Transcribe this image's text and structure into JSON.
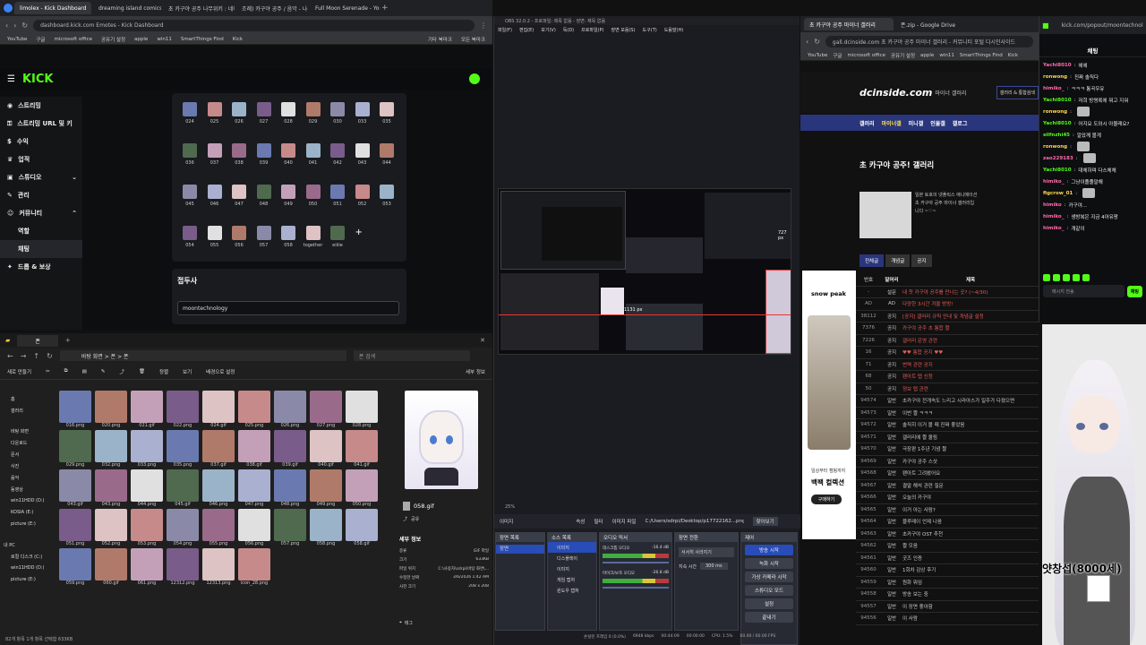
{
  "browser_left": {
    "tabs": [
      "limolex - Kick Dashboard",
      "dreaming island comics princess",
      "초 카구야 공주 나무위키 : 네이버",
      "조례) 카구야 공주 / 음악 - 나무위키",
      "Full Moon Serenade - YouTube"
    ],
    "url": "dashboard.kick.com  Emotes - Kick Dashboard",
    "bookmarks": [
      "YouTube",
      "구글",
      "microsoft office",
      "공유기 설정",
      "apple",
      "win11",
      "SmartThings Find",
      "Kick",
      "기타 북마크",
      "모든 북마크"
    ]
  },
  "kick": {
    "logo": "KICK",
    "sidebar": [
      "스트리밍",
      "스트리밍 URL 및 키",
      "수익",
      "업적",
      "스튜디오",
      "관리",
      "커뮤니티",
      "역할",
      "채팅",
      "드롭 & 보상"
    ],
    "emote_rows": [
      [
        "024",
        "025",
        "026",
        "027",
        "028",
        "029",
        "030",
        "033",
        "035"
      ],
      [
        "036",
        "037",
        "038",
        "039",
        "040",
        "041",
        "042",
        "043",
        "044"
      ],
      [
        "045",
        "046",
        "047",
        "048",
        "049",
        "050",
        "051",
        "052",
        "053"
      ],
      [
        "054",
        "055",
        "056",
        "057",
        "058",
        "together",
        "eiiiie"
      ]
    ],
    "section_title": "접두사",
    "prefix_value": "moontechnology"
  },
  "explorer": {
    "tab": "폰",
    "path": "바탕 화면  >  폰  >  폰",
    "search_placeholder": "폰 검색",
    "toolbar": [
      "새로 만들기",
      "정렬",
      "보기",
      "배경으로 설정",
      "세부 정보"
    ],
    "nav_items": [
      "홈",
      "갤러리",
      "바탕 화면",
      "다운로드",
      "문서",
      "사진",
      "음악",
      "동영상",
      "win11HDD (D:)",
      "KOSIA (E:)",
      "picture (E:)",
      "내 PC",
      "로컬 디스크 (C:)",
      "win11HDD (D:)",
      "picture (E:)"
    ],
    "files": [
      "016.png",
      "020.png",
      "021.gif",
      "022.png",
      "024.gif",
      "025.png",
      "026.png",
      "027.png",
      "028.png",
      "029.png",
      "032.png",
      "033.png",
      "035.png",
      "037.gif",
      "038.gif",
      "039.gif",
      "040.gif",
      "041.gif",
      "043.gif",
      "043.png",
      "044.png",
      "045.gif",
      "046.png",
      "047.png",
      "048.png",
      "049.png",
      "050.png",
      "051.png",
      "052.png",
      "053.png",
      "054.png",
      "055.png",
      "056.png",
      "057.png",
      "058.png",
      "058.gif",
      "059.png",
      "060.gif",
      "061.png",
      "12312.png",
      "12313.png",
      "icon_28.png"
    ],
    "preview_file": "058.gif",
    "preview_share": "공유",
    "detail_title": "세부 정보",
    "details": [
      [
        "종류",
        "GIF 파일"
      ],
      [
        "크기",
        "633KB"
      ],
      [
        "파일 위치",
        "C:\\사용자\\sdrpi\\바탕 화면\\..."
      ],
      [
        "수정한 날짜",
        "3/6/2026 1:42 AM"
      ],
      [
        "사진 크기",
        "208 x 208"
      ]
    ],
    "status": "82개 항목   1개 항목 선택함 633KB",
    "tag_button": "태그"
  },
  "obs": {
    "title": "OBS 32.0.2 - 프로파일: 제목 없음 - 장면: 제목 없음",
    "menu": [
      "파일(F)",
      "편집(E)",
      "보기(V)",
      "독(D)",
      "프로파일(P)",
      "장면 모음(S)",
      "도구(T)",
      "도움말(H)"
    ],
    "zoom": "25%",
    "image_label": "1131 px",
    "px_label": "727 px",
    "toolbar": [
      "이미지",
      "속성",
      "필터",
      "이미지 파일",
      "C:/Users/sdrpi/Desktop/p17722162...png",
      "찾아보기"
    ],
    "scene_panel": "장면 목록",
    "scenes": [
      "장면"
    ],
    "source_panel": "소스 목록",
    "sources": [
      "이미지",
      "디스플레이",
      "이미지",
      "게임 캡처",
      "윈도우 캡처"
    ],
    "audio_panel": "오디오 믹서",
    "audio": [
      {
        "name": "데스크톱 오디오",
        "db": "-16.4 dB"
      },
      {
        "name": "마이크/보조 오디오",
        "db": "-26.8 dB"
      }
    ],
    "transition_panel": "장면 전환",
    "transition": "서서히 사라지기",
    "duration_label": "지속 시간",
    "duration": "300 ms",
    "controls_panel": "제어",
    "controls": [
      "방송 시작",
      "녹화 시작",
      "가상 카메라 시작",
      "스튜디오 모드",
      "설정",
      "끝내기"
    ],
    "status": [
      "손실된 프레임 0 (0.0%)",
      "6948 kbps",
      "00:44:09",
      "00:00:00",
      "CPU: 1.5%",
      "60.00 / 60.00 FPS"
    ]
  },
  "browser_right": {
    "tabs": [
      "초 카구야 공주 마이너 갤러리",
      "폰.zip - Google Drive"
    ],
    "url": "gall.dcinside.com  초 카구야 공주 마이너 갤러리 - 커뮤니티 포털 디시인사이드",
    "bookmarks": [
      "YouTube",
      "구글",
      "microsoft office",
      "공유기 설정",
      "apple",
      "win11",
      "SmartThings Find",
      "Kick"
    ]
  },
  "dc": {
    "logo": "dcinside.com",
    "logo_sub": "마이너 갤러리",
    "search_btn": "갤러리 & 통합검색",
    "nav": [
      "갤러리",
      "마이너갤",
      "미니갤",
      "인물갤",
      "갤로그"
    ],
    "gallery_title": "초 카구야 공주! 갤러리",
    "intro": "일본 토호의 넷플릭스 애니메이션 초 카구야 공주 마이너 갤러리입니다 ~♡~",
    "tabs": [
      "전체글",
      "개념글",
      "공지"
    ],
    "cols": [
      "번호",
      "말머리",
      "제목"
    ],
    "ad_brand": "snow peak",
    "ad_text1": "일상부터 캠핑까지",
    "ad_text2": "백팩 컬렉션",
    "ad_btn": "구매하기",
    "rows": [
      [
        "-",
        "설문",
        "내 첫 카구야 공주를 만나는 곳? (~4/30)"
      ],
      [
        "AD",
        "AD",
        "다양한 3시간 겨울 방방!"
      ],
      [
        "38112",
        "공지",
        "[공지] 갤러리 규칙 안내 및 개념글 설정"
      ],
      [
        "7376",
        "공지",
        "카구야 공주 초 통합 짤"
      ],
      [
        "7226",
        "공지",
        "갤러리 운영 관련"
      ],
      [
        "16",
        "공지",
        "♥♥ 통합 공지 ♥♥"
      ],
      [
        "71",
        "공지",
        "번역 관련 공지"
      ],
      [
        "68",
        "공지",
        "팬아트 탭 신청"
      ],
      [
        "50",
        "공지",
        "정보 탭 관련"
      ],
      [
        "94574",
        "일반",
        "초카구야 전개속도 느리고 시라아스가 일주가 다졌으면"
      ],
      [
        "94573",
        "일반",
        "이번 짤 ㅋㅋㅋ"
      ],
      [
        "94572",
        "일반",
        "솔직히 이거 볼 때 진짜 좋았음"
      ],
      [
        "94571",
        "일반",
        "갤러리에 짤 올림"
      ],
      [
        "94570",
        "일반",
        "극장판 1주년 기념 짤"
      ],
      [
        "94569",
        "일반",
        "카구야 공주 스샷"
      ],
      [
        "94568",
        "일반",
        "팬아트 그려봤어요"
      ],
      [
        "94567",
        "일반",
        "결말 해석 관련 질문"
      ],
      [
        "94566",
        "일반",
        "오늘의 카구야"
      ],
      [
        "94565",
        "일반",
        "이거 아는 사람?"
      ],
      [
        "94564",
        "일반",
        "블루레이 언제 나옴"
      ],
      [
        "94563",
        "일반",
        "초카구야 OST 추천"
      ],
      [
        "94562",
        "일반",
        "짤 모음"
      ],
      [
        "94561",
        "일반",
        "굿즈 인증"
      ],
      [
        "94560",
        "일반",
        "1회차 감상 후기"
      ],
      [
        "94559",
        "일반",
        "원화 뭐임"
      ],
      [
        "94558",
        "일반",
        "방송 보는 중"
      ],
      [
        "94557",
        "일반",
        "이 장면 좋아함"
      ],
      [
        "94556",
        "일반",
        "이 사람"
      ]
    ]
  },
  "kick_chat": {
    "url": "kick.com/popout/moontechnology",
    "header": "채팅",
    "messages": [
      {
        "user": "Yachi8010",
        "text": "헤헤",
        "c": "pink"
      },
      {
        "user": "ronwong",
        "text": "진짜 솔직다",
        "c": "yellow"
      },
      {
        "user": "himiko_",
        "text": "ㅋㅋㅋ 통곡우유",
        "c": "pink"
      },
      {
        "user": "Yachi8010",
        "text": "저희 방명록에 뭐고 지워",
        "c": "green"
      },
      {
        "user": "ronwong",
        "text": "",
        "c": "yellow"
      },
      {
        "user": "Yachi8010",
        "text": "어지요 도와시 아몰래요?",
        "c": "green"
      },
      {
        "user": "silfnzhi45",
        "text": "알았께 볼게",
        "c": "green"
      },
      {
        "user": "ronwong",
        "text": "",
        "c": "yellow"
      },
      {
        "user": "zao229183",
        "text": "",
        "c": "pink"
      },
      {
        "user": "Yachi8010",
        "text": "대체하며 다스체체",
        "c": "green"
      },
      {
        "user": "himiko_",
        "text": "그냥이졸졸말해",
        "c": "pink"
      },
      {
        "user": "figcrow_01",
        "text": "",
        "c": "yellow"
      },
      {
        "user": "himiko",
        "text": "카구야...",
        "c": "pink"
      },
      {
        "user": "himiko_",
        "text": "생방복은 지금 4아유팡",
        "c": "pink"
      },
      {
        "user": "himiko_",
        "text": "개같이",
        "c": "pink"
      }
    ],
    "input_placeholder": "메시지 전송",
    "send": "채팅"
  },
  "vtuber_caption": "얏창섭(8000세)"
}
